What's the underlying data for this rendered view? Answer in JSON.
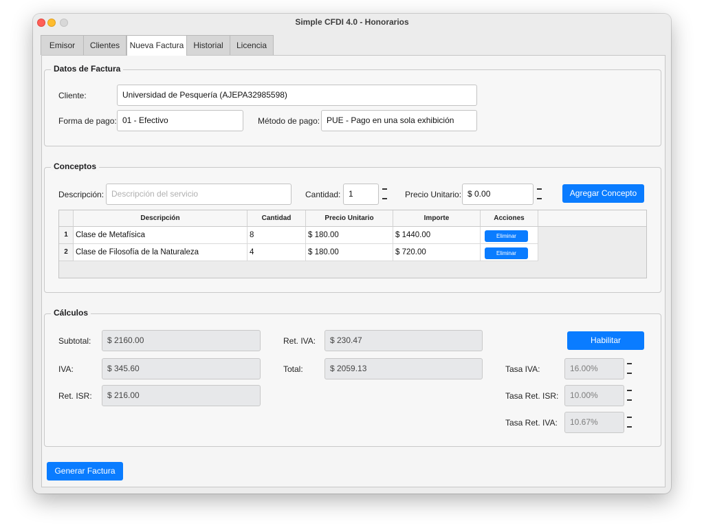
{
  "window": {
    "title": "Simple CFDI 4.0 - Honorarios"
  },
  "tabs": [
    {
      "label": "Emisor"
    },
    {
      "label": "Clientes"
    },
    {
      "label": "Nueva Factura"
    },
    {
      "label": "Historial"
    },
    {
      "label": "Licencia"
    }
  ],
  "active_tab": "Nueva Factura",
  "datos_factura": {
    "title": "Datos de Factura",
    "cliente_label": "Cliente:",
    "cliente_value": "Universidad de Pesquería (AJEPA32985598)",
    "forma_pago_label": "Forma de pago:",
    "forma_pago_value": "01 - Efectivo",
    "metodo_pago_label": "Método de pago:",
    "metodo_pago_value": "PUE - Pago en una sola exhibición"
  },
  "conceptos": {
    "title": "Conceptos",
    "descripcion_label": "Descripción:",
    "descripcion_placeholder": "Descripción del servicio",
    "cantidad_label": "Cantidad:",
    "cantidad_value": "1",
    "precio_label": "Precio Unitario:",
    "precio_value": "$ 0.00",
    "agregar_label": "Agregar Concepto",
    "table": {
      "headers": [
        "Descripción",
        "Cantidad",
        "Precio Unitario",
        "Importe",
        "Acciones"
      ],
      "rows": [
        {
          "num": "1",
          "descripcion": "Clase de Metafísica",
          "cantidad": "8",
          "precio": "$ 180.00",
          "importe": "$ 1440.00",
          "accion": "Eliminar"
        },
        {
          "num": "2",
          "descripcion": "Clase de Filosofía de la Naturaleza",
          "cantidad": "4",
          "precio": "$ 180.00",
          "importe": "$ 720.00",
          "accion": "Eliminar"
        }
      ]
    }
  },
  "calculos": {
    "title": "Cálculos",
    "subtotal_label": "Subtotal:",
    "subtotal_value": "$ 2160.00",
    "iva_label": "IVA:",
    "iva_value": "$ 345.60",
    "ret_isr_label": "Ret. ISR:",
    "ret_isr_value": "$ 216.00",
    "ret_iva_label": "Ret. IVA:",
    "ret_iva_value": "$ 230.47",
    "total_label": "Total:",
    "total_value": "$ 2059.13",
    "habilitar_label": "Habilitar",
    "tasa_iva_label": "Tasa IVA:",
    "tasa_iva_value": "16.00%",
    "tasa_ret_isr_label": "Tasa Ret. ISR:",
    "tasa_ret_isr_value": "10.00%",
    "tasa_ret_iva_label": "Tasa Ret. IVA:",
    "tasa_ret_iva_value": "10.67%"
  },
  "footer": {
    "generar_label": "Generar Factura"
  },
  "colors": {
    "accent": "#0a7cff",
    "close": "#ff5f57",
    "minimize": "#febc2e"
  }
}
